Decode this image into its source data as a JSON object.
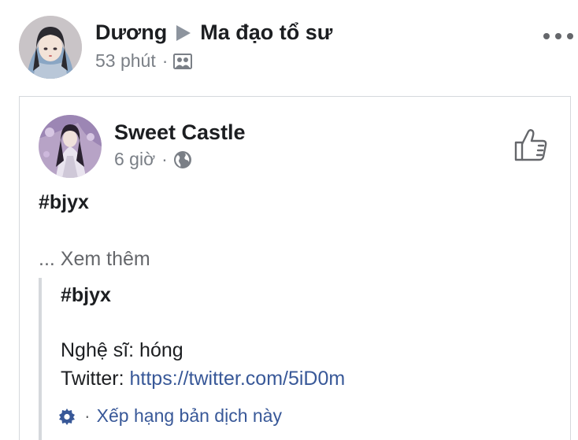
{
  "outer_post": {
    "author": "Dương",
    "group": "Ma đạo tổ sư",
    "time": "53 phút",
    "separator": "·",
    "audience_icon": "group-icon"
  },
  "shared_post": {
    "author": "Sweet Castle",
    "time": "6 giờ",
    "separator": "·",
    "audience_icon": "globe-icon",
    "hashtag": "#bjyx",
    "see_more_prefix": "...",
    "see_more": "Xem thêm",
    "translation": {
      "hashtag": "#bjyx",
      "line1": "Nghệ sĩ: hóng",
      "line2_label": "Twitter: ",
      "line2_link": "https://twitter.com/5iD0m",
      "rate_separator": "·",
      "rate_label": "Xếp hạng bản dịch này"
    }
  },
  "colors": {
    "link": "#385898",
    "meta_text": "#7a7f86",
    "border": "#d5d8dc"
  }
}
